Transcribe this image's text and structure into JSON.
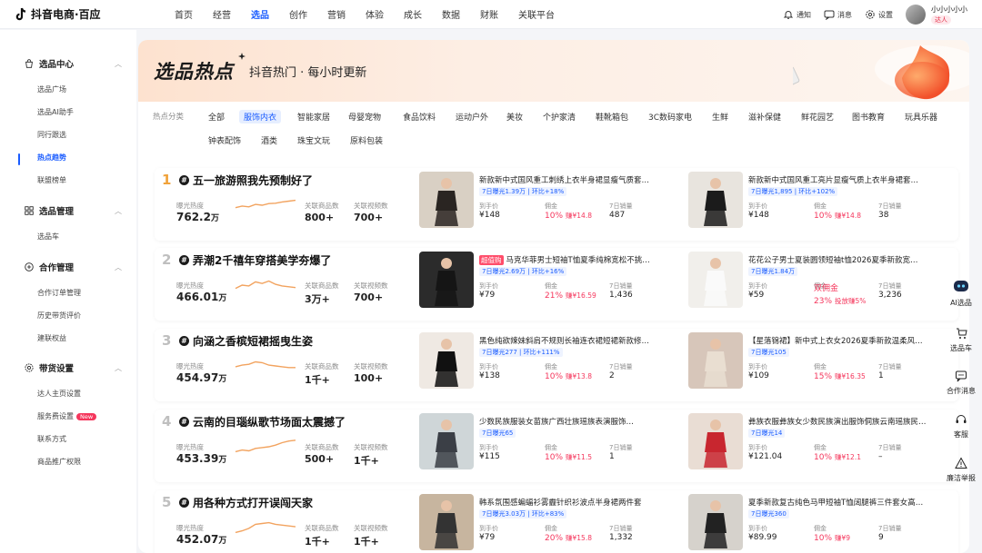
{
  "app": {
    "logo": "抖音电商·百应"
  },
  "nav": [
    "首页",
    "经营",
    "选品",
    "创作",
    "营销",
    "体验",
    "成长",
    "数据",
    "财账",
    "关联平台"
  ],
  "nav_active_index": 2,
  "tools": {
    "notify": "通知",
    "messages": "消息",
    "settings": "设置"
  },
  "user": {
    "name": "小小小小小",
    "badge": "达人"
  },
  "sidebar": {
    "groups": [
      {
        "label": "选品中心",
        "icon": "bag-icon",
        "items": [
          "选品广场",
          "选品AI助手",
          "同行跟选",
          "热点趋势",
          "联盟榜单"
        ]
      },
      {
        "label": "选品管理",
        "icon": "grid-icon",
        "items": [
          "选品车"
        ]
      },
      {
        "label": "合作管理",
        "icon": "handshake-icon",
        "items": [
          "合作订单管理",
          "历史带货评价",
          "建联权益"
        ]
      },
      {
        "label": "带货设置",
        "icon": "gear-icon",
        "items": [
          "达人主页设置",
          "服务费设置",
          "联系方式",
          "商品推广权限"
        ]
      }
    ],
    "active_item": "热点趋势",
    "new_badge": "New"
  },
  "hero": {
    "title": "选品热点",
    "subtitle": "抖音热门 · 每小时更新"
  },
  "categories": {
    "label": "热点分类",
    "row1": [
      "全部",
      "服饰内衣",
      "智能家居",
      "母婴宠物",
      "食品饮料",
      "运动户外",
      "美妆",
      "个护家清",
      "鞋靴箱包",
      "3C数码家电",
      "生鲜",
      "滋补保健",
      "鲜花园艺",
      "图书教育",
      "玩具乐器"
    ],
    "row2": [
      "钟表配饰",
      "酒类",
      "珠宝文玩",
      "原料包装"
    ],
    "active": "服饰内衣"
  },
  "labels": {
    "exposure_heat": "曝光热度",
    "related_products": "关联商品数",
    "related_videos": "关联视频数",
    "price": "到手价",
    "commission": "佣金",
    "sales7d": "7日销量",
    "earn": "赚"
  },
  "topics": [
    {
      "rank": "1",
      "title": "五一旅游照我先预制好了",
      "heat": "762.2",
      "heat_unit": "万",
      "products": "800+",
      "videos": "700+",
      "spark": [
        0.35,
        0.45,
        0.4,
        0.55,
        0.5,
        0.6,
        0.62,
        0.7,
        0.75,
        0.8
      ],
      "items": [
        {
          "title": "新款新中式国风重工刺绣上衣半身裙显瘦气质套…",
          "stat": "7日曝光1.39万 | 环比+18%",
          "price": "¥148",
          "rate": "10%",
          "earn": "¥14.8",
          "sales": "487"
        },
        {
          "title": "新款新中式国风重工亮片显瘦气质上衣半身裙套…",
          "stat": "7日曝光1,895 | 环比+102%",
          "price": "¥148",
          "rate": "10%",
          "earn": "¥14.8",
          "sales": "38"
        }
      ]
    },
    {
      "rank": "2",
      "title": "弄潮2千禧年穿搭美学夯爆了",
      "heat": "466.01",
      "heat_unit": "万",
      "products": "3万+",
      "videos": "700+",
      "spark": [
        0.3,
        0.5,
        0.45,
        0.7,
        0.6,
        0.75,
        0.55,
        0.45,
        0.4,
        0.35
      ],
      "items": [
        {
          "tag": "超值购",
          "title": "马克华菲男士短袖T恤夏季纯棉宽松不挑…",
          "stat": "7日曝光2.69万 | 环比+16%",
          "price": "¥79",
          "rate": "21%",
          "earn": "¥16.59",
          "sales": "1,436"
        },
        {
          "title": "花花公子男士夏装圆领短袖t恤2026夏季新款宽…",
          "stat": "7日曝光1.84万",
          "price": "¥59",
          "rate": "双佣金",
          "rate2": "23%",
          "earn_label": "投放赚5%",
          "sales": "3,236"
        }
      ]
    },
    {
      "rank": "3",
      "title": "向涵之香槟短裙摇曳生姿",
      "heat": "454.97",
      "heat_unit": "万",
      "products": "1千+",
      "videos": "100+",
      "spark": [
        0.45,
        0.55,
        0.6,
        0.75,
        0.7,
        0.55,
        0.5,
        0.45,
        0.4,
        0.4
      ],
      "items": [
        {
          "title": "黑色纯欲辣妹斜肩不规则长袖连衣裙短裙新款修…",
          "stat": "7日曝光277 | 环比+111%",
          "price": "¥138",
          "rate": "10%",
          "earn": "¥13.8",
          "sales": "2"
        },
        {
          "title": "【星落锦裙】新中式上衣女2026夏季新款温柔风…",
          "stat": "7日曝光105",
          "price": "¥109",
          "rate": "15%",
          "earn": "¥16.35",
          "sales": "1"
        }
      ]
    },
    {
      "rank": "4",
      "title": "云南的目瑙纵歌节场面太震撼了",
      "heat": "453.39",
      "heat_unit": "万",
      "products": "500+",
      "videos": "1千+",
      "spark": [
        0.2,
        0.3,
        0.25,
        0.4,
        0.45,
        0.5,
        0.6,
        0.75,
        0.85,
        0.9
      ],
      "items": [
        {
          "title": "少数民族服装女苗族广西壮族瑶族表演服饰…",
          "stat": "7日曝光65",
          "price": "¥115",
          "rate": "10%",
          "earn": "¥11.5",
          "sales": "1"
        },
        {
          "title": "彝族衣服彝族女少数民族演出服饰侗族云南瑶族民…",
          "stat": "7日曝光14",
          "price": "¥121.04",
          "rate": "10%",
          "earn": "¥12.1",
          "sales": "–"
        }
      ]
    },
    {
      "rank": "5",
      "title": "用各种方式打开误闯天家",
      "heat": "452.07",
      "heat_unit": "万",
      "products": "1千+",
      "videos": "1千+",
      "spark": [
        0.2,
        0.3,
        0.45,
        0.7,
        0.75,
        0.8,
        0.7,
        0.65,
        0.6,
        0.55
      ],
      "items": [
        {
          "title": "韩系氛围感蝙蝠衫雾霾针织衫波点半身裙两件套",
          "stat": "7日曝光3.03万 | 环比+83%",
          "price": "¥79",
          "rate": "20%",
          "earn": "¥15.8",
          "sales": "1,332"
        },
        {
          "title": "夏季新款复古纯色马甲短袖T恤阔腿裤三件套女高…",
          "stat": "7日曝光360",
          "price": "¥89.99",
          "rate": "10%",
          "earn": "¥9",
          "sales": "9"
        }
      ]
    }
  ],
  "rail": [
    "AI选品",
    "选品车",
    "合作消息",
    "客服",
    "廉洁举报"
  ],
  "colors": {
    "accent": "#1a5cff",
    "rank_gold": "#f0a23a",
    "commission_red": "#f5365c",
    "spark": "#f2a35f"
  }
}
